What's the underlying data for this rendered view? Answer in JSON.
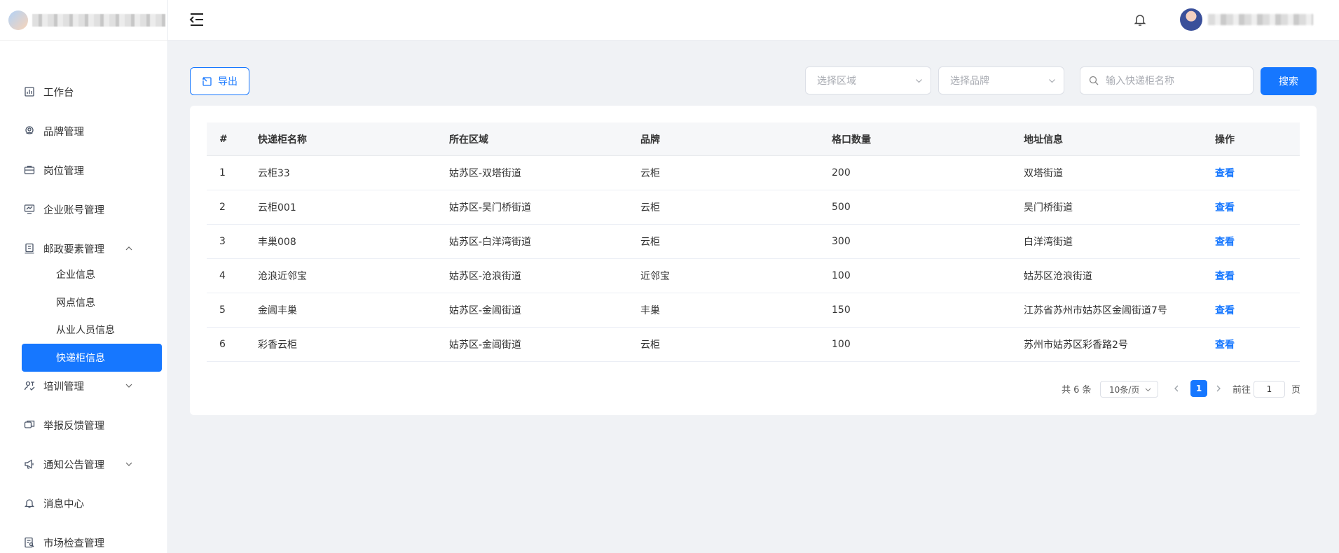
{
  "sidebar": {
    "items": [
      {
        "label": "工作台",
        "icon": "chart-icon"
      },
      {
        "label": "品牌管理",
        "icon": "brand-icon"
      },
      {
        "label": "岗位管理",
        "icon": "briefcase-icon"
      },
      {
        "label": "企业账号管理",
        "icon": "monitor-chart-icon"
      },
      {
        "label": "邮政要素管理",
        "icon": "building-icon",
        "expanded": true
      },
      {
        "label": "培训管理",
        "icon": "training-icon"
      },
      {
        "label": "举报反馈管理",
        "icon": "feedback-icon"
      },
      {
        "label": "通知公告管理",
        "icon": "megaphone-icon"
      },
      {
        "label": "消息中心",
        "icon": "bell-icon"
      },
      {
        "label": "市场检查管理",
        "icon": "inspection-icon"
      }
    ],
    "sub_items": [
      "企业信息",
      "网点信息",
      "从业人员信息",
      "快递柜信息"
    ],
    "active_sub": "快递柜信息"
  },
  "toolbar": {
    "export_label": "导出",
    "region_placeholder": "选择区域",
    "brand_placeholder": "选择品牌",
    "search_placeholder": "输入快递柜名称",
    "search_label": "搜索"
  },
  "table": {
    "columns": [
      "#",
      "快递柜名称",
      "所在区域",
      "品牌",
      "格口数量",
      "地址信息",
      "操作"
    ],
    "rows": [
      {
        "no": "1",
        "name": "云柜33",
        "region": "姑苏区-双塔街道",
        "brand": "云柜",
        "slots": "200",
        "address": "双塔街道",
        "action": "查看"
      },
      {
        "no": "2",
        "name": "云柜001",
        "region": "姑苏区-吴门桥街道",
        "brand": "云柜",
        "slots": "500",
        "address": "吴门桥街道",
        "action": "查看"
      },
      {
        "no": "3",
        "name": "丰巢008",
        "region": "姑苏区-白洋湾街道",
        "brand": "云柜",
        "slots": "300",
        "address": "白洋湾街道",
        "action": "查看"
      },
      {
        "no": "4",
        "name": "沧浪近邻宝",
        "region": "姑苏区-沧浪街道",
        "brand": "近邻宝",
        "slots": "100",
        "address": "姑苏区沧浪街道",
        "action": "查看"
      },
      {
        "no": "5",
        "name": "金阊丰巢",
        "region": "姑苏区-金阊街道",
        "brand": "丰巢",
        "slots": "150",
        "address": "江苏省苏州市姑苏区金阊街道7号",
        "action": "查看"
      },
      {
        "no": "6",
        "name": "彩香云柜",
        "region": "姑苏区-金阊街道",
        "brand": "云柜",
        "slots": "100",
        "address": "苏州市姑苏区彩香路2号",
        "action": "查看"
      }
    ]
  },
  "pagination": {
    "total_text": "共 6 条",
    "page_size": "10条/页",
    "current_page": "1",
    "goto_label": "前往",
    "goto_value": "1",
    "page_suffix": "页"
  },
  "colors": {
    "accent": "#1677ff",
    "background": "#f0f2f5"
  }
}
